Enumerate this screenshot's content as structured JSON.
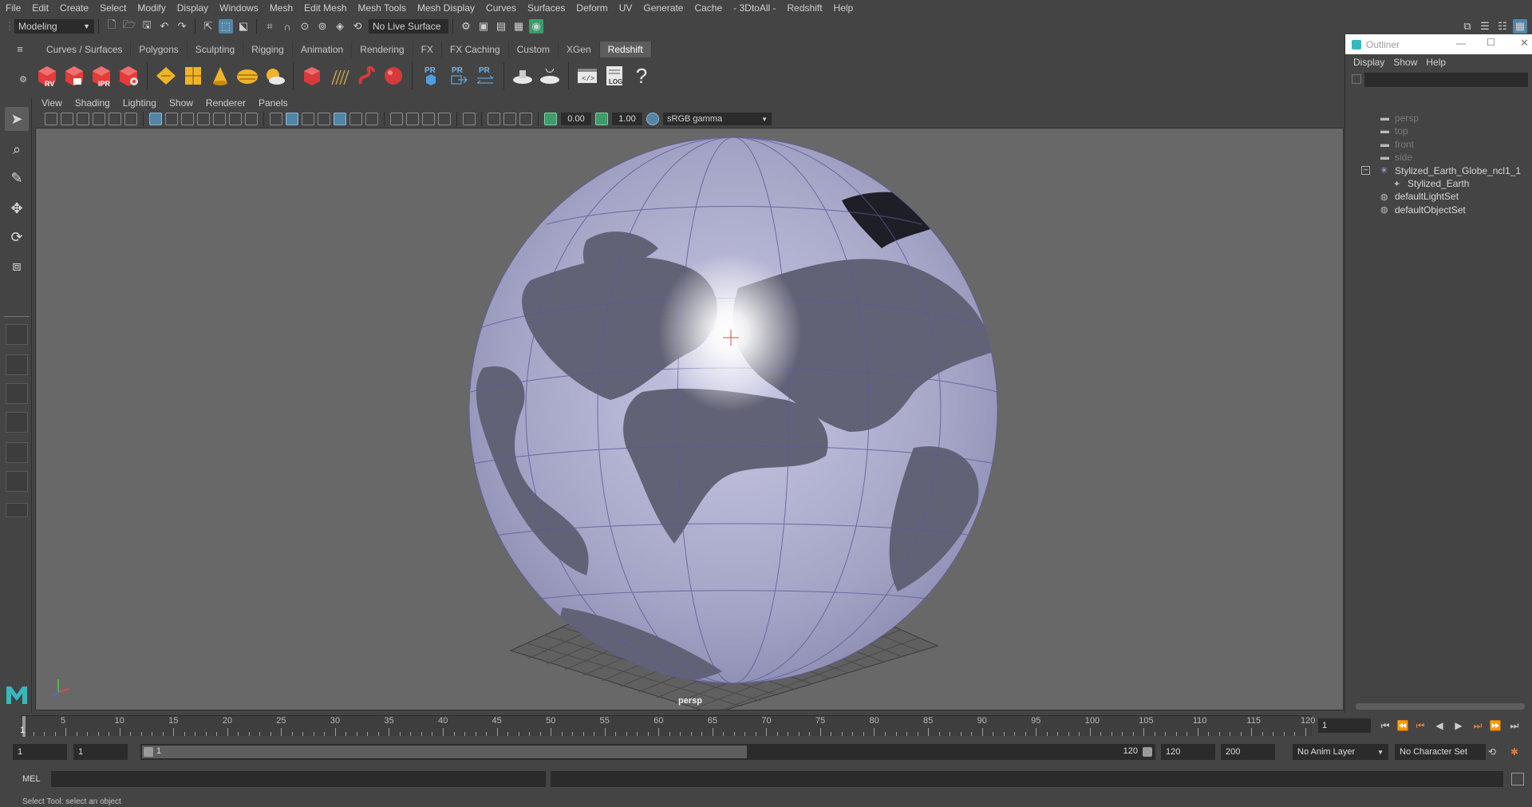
{
  "menubar": {
    "items": [
      "File",
      "Edit",
      "Create",
      "Select",
      "Modify",
      "Display",
      "Windows",
      "Mesh",
      "Edit Mesh",
      "Mesh Tools",
      "Mesh Display",
      "Curves",
      "Surfaces",
      "Deform",
      "UV",
      "Generate",
      "Cache",
      "- 3DtoAll -",
      "Redshift",
      "Help"
    ]
  },
  "statusline": {
    "menuset": "Modeling",
    "live_surface": "No Live Surface"
  },
  "shelf": {
    "tabs": [
      "Curves / Surfaces",
      "Polygons",
      "Sculpting",
      "Rigging",
      "Animation",
      "Rendering",
      "FX",
      "FX Caching",
      "Custom",
      "XGen",
      "Redshift"
    ],
    "active_tab": "Redshift",
    "icons": [
      "RV",
      "IPR",
      "PR",
      "PR",
      "PR",
      "LOG",
      "?"
    ]
  },
  "panel": {
    "menus": [
      "View",
      "Shading",
      "Lighting",
      "Show",
      "Renderer",
      "Panels"
    ],
    "exposure": "0.00",
    "gamma": "1.00",
    "color_space": "sRGB gamma",
    "camera_label": "persp"
  },
  "outliner": {
    "title": "Outliner",
    "menus": [
      "Display",
      "Show",
      "Help"
    ],
    "items": [
      {
        "label": "persp",
        "icon": "camera-icon",
        "dim": true
      },
      {
        "label": "top",
        "icon": "camera-icon",
        "dim": true
      },
      {
        "label": "front",
        "icon": "camera-icon",
        "dim": true
      },
      {
        "label": "side",
        "icon": "camera-icon",
        "dim": true
      },
      {
        "label": "Stylized_Earth_Globe_ncl1_1",
        "icon": "group-icon",
        "dim": false
      },
      {
        "label": "Stylized_Earth",
        "icon": "mesh-icon",
        "dim": false
      },
      {
        "label": "defaultLightSet",
        "icon": "set-icon",
        "dim": false
      },
      {
        "label": "defaultObjectSet",
        "icon": "set-icon",
        "dim": false
      }
    ]
  },
  "timeline": {
    "ticks": [
      5,
      10,
      15,
      20,
      25,
      30,
      35,
      40,
      45,
      50,
      55,
      60,
      65,
      70,
      75,
      80,
      85,
      90,
      95,
      100,
      105,
      110,
      115,
      120
    ],
    "start": 1,
    "end": 120,
    "current_frame": "1"
  },
  "range": {
    "start_frame": "1",
    "playback_start": "1",
    "slider_start": "1",
    "slider_end": "120",
    "playback_end": "120",
    "end_frame": "200",
    "anim_layer": "No Anim Layer",
    "character_set": "No Character Set"
  },
  "cmdline": {
    "label": "MEL"
  },
  "helpline": {
    "text": "Select Tool: select an object"
  },
  "colors": {
    "accent": "#5285a6",
    "globe": "#a4a4c6",
    "redshift_red": "#e43b3b",
    "shelf_gold": "#f0b429"
  }
}
